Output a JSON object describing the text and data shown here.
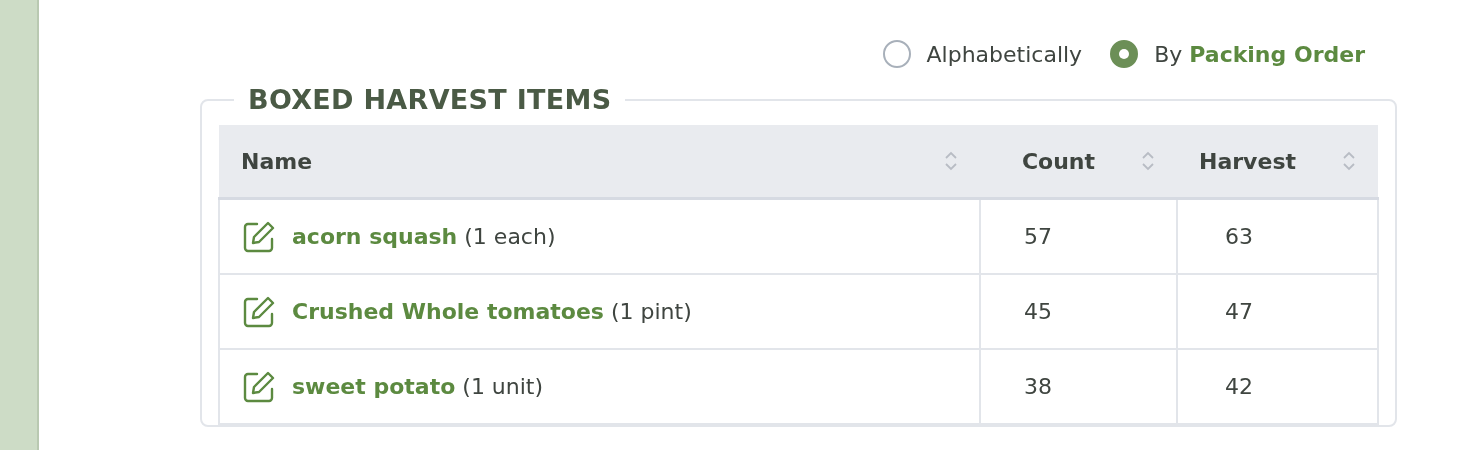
{
  "sort_options": [
    {
      "label": "Alphabetically",
      "selected": false
    },
    {
      "label": "By **Packing Order**",
      "selected": true
    }
  ],
  "section": {
    "title": "BOXED HARVEST ITEMS"
  },
  "table": {
    "columns": [
      "Name",
      "Count",
      "Harvest"
    ],
    "rows": [
      {
        "name": "acorn squash",
        "unit": "(1 each)",
        "count": "57",
        "harvest": "63"
      },
      {
        "name": "Crushed Whole tomatoes",
        "unit": "(1 pint)",
        "count": "45",
        "harvest": "47"
      },
      {
        "name": "sweet potato",
        "unit": "(1 unit)",
        "count": "38",
        "harvest": "42"
      }
    ]
  }
}
